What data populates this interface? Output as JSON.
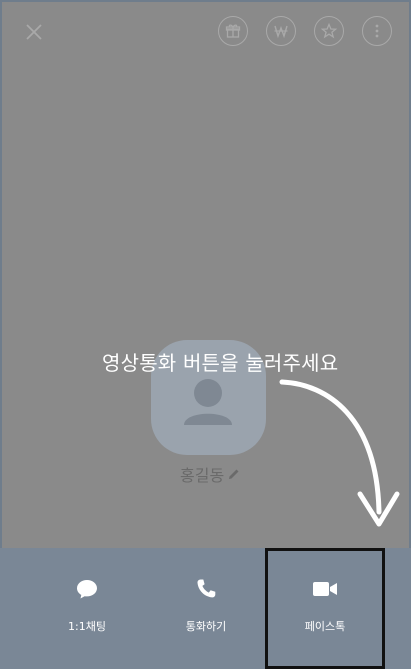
{
  "profile": {
    "name": "홍길동"
  },
  "hint": {
    "text": "영상통화 버튼을 눌러주세요"
  },
  "top_bar": {
    "icons": [
      "close-icon",
      "gift-icon",
      "won-icon",
      "star-icon",
      "more-icon"
    ]
  },
  "actions": [
    {
      "label": "1:1채팅",
      "icon": "chat-icon"
    },
    {
      "label": "통화하기",
      "icon": "phone-icon"
    },
    {
      "label": "페이스톡",
      "icon": "video-icon"
    }
  ],
  "colors": {
    "dim_background": "#8a8a8a",
    "bottom_bar": "#7a8796",
    "hint_text": "#ffffff",
    "highlight_border": "#111111"
  }
}
